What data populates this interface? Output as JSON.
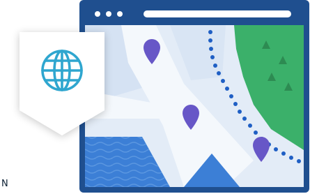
{
  "illustration": {
    "window_control_dots": 3,
    "map_pin_count": 3,
    "badge_icon": "globe-icon",
    "colors": {
      "window_frame": "#1f4f8f",
      "map_land": "#e3ecf7",
      "map_road": "#f4f8fc",
      "map_water": "#3c7fd6",
      "map_park": "#3bb06a",
      "map_trees": "#2d8b52",
      "route_dots": "#1f5fc4",
      "map_pin": "#6757c7",
      "badge_fill": "#ffffff",
      "globe_stroke": "#2fa6cf"
    }
  },
  "footer": {
    "stray_char": "N"
  }
}
